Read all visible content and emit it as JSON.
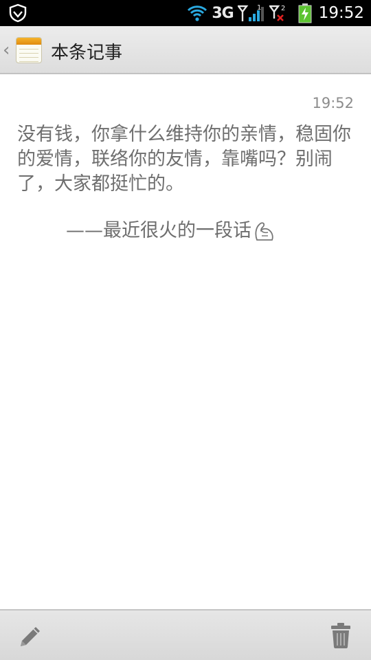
{
  "status_bar": {
    "network_type": "3G",
    "sim1_label": "1",
    "sim2_label": "2",
    "time": "19:52"
  },
  "action_bar": {
    "title": "本条记事"
  },
  "note": {
    "time": "19:52",
    "body": "没有钱，你拿什么维持你的亲情，稳固你的爱情，联络你的友情，靠嘴吗？别闹了，大家都挺忙的。",
    "signature": "——最近很火的一段话"
  },
  "bottom_bar": {
    "edit_icon": "pencil-icon",
    "delete_icon": "trash-icon"
  },
  "colors": {
    "status_bar_bg": "#000000",
    "battery_green": "#5cc431",
    "signal_blue": "#2aa9e0",
    "no_signal_red": "#e02020",
    "note_text": "#6e6e6e",
    "icon_gray": "#777777"
  }
}
